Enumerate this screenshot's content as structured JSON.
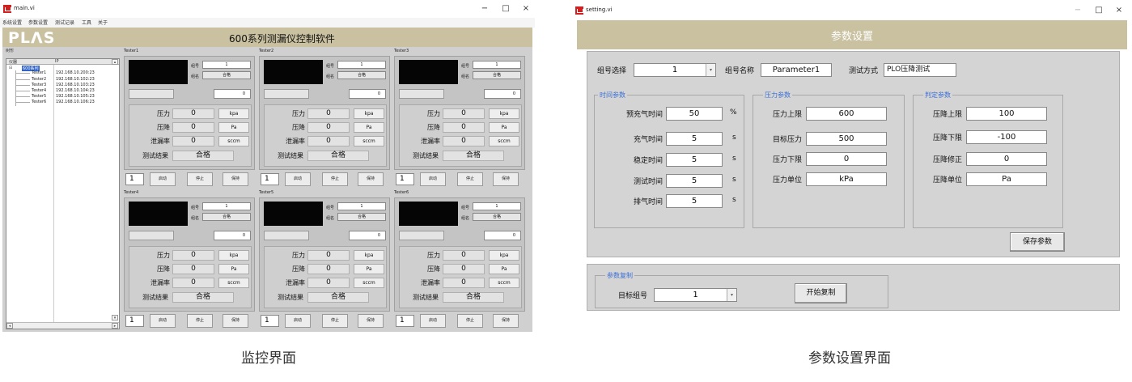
{
  "win1": {
    "title": "main.vi",
    "controls": [
      "−",
      "□",
      "×"
    ],
    "menu": [
      "系统设置",
      "参数设置",
      "测试记录",
      "工具",
      "关于"
    ],
    "logo": "PLΛS",
    "app_title": "600系列测漏仪控制软件",
    "tree": {
      "caption": "树形",
      "col_instrument": "仪器",
      "col_ip": "IP",
      "root": "600系列",
      "items": [
        {
          "name": "Tester1",
          "ip": "192.168.10.200:23"
        },
        {
          "name": "Tester2",
          "ip": "192.168.10.102:23"
        },
        {
          "name": "Tester3",
          "ip": "192.168.10.103:23"
        },
        {
          "name": "Tester4",
          "ip": "192.168.10.104:23"
        },
        {
          "name": "Tester5",
          "ip": "192.168.10.105:23"
        },
        {
          "name": "Tester6",
          "ip": "192.168.10.106:23"
        }
      ],
      "scroll_up": "▴",
      "scroll_down": "▾",
      "scroll_left": "◂",
      "scroll_right": "▸"
    },
    "labels": {
      "group_no": "组号",
      "group_name": "组名",
      "pressure": "压力",
      "pressure_drop": "压降",
      "leak_rate": "泄漏率",
      "result": "测试结果",
      "start": "启动",
      "stop": "停止",
      "hold": "保持"
    },
    "testers": [
      {
        "name": "Tester1",
        "group_no": "1",
        "group_name": "合格",
        "counter": "0",
        "pressure": "0",
        "pressure_unit": "kpa",
        "drop": "0",
        "drop_unit": "Pa",
        "leak": "0",
        "leak_unit": "sccm",
        "result": "合格",
        "count": "1"
      },
      {
        "name": "Tester2",
        "group_no": "1",
        "group_name": "合格",
        "counter": "0",
        "pressure": "0",
        "pressure_unit": "kpa",
        "drop": "0",
        "drop_unit": "Pa",
        "leak": "0",
        "leak_unit": "sccm",
        "result": "合格",
        "count": "1"
      },
      {
        "name": "Tester3",
        "group_no": "1",
        "group_name": "合格",
        "counter": "0",
        "pressure": "0",
        "pressure_unit": "kpa",
        "drop": "0",
        "drop_unit": "Pa",
        "leak": "0",
        "leak_unit": "sccm",
        "result": "合格",
        "count": "1"
      },
      {
        "name": "Tester4",
        "group_no": "1",
        "group_name": "合格",
        "counter": "0",
        "pressure": "0",
        "pressure_unit": "kpa",
        "drop": "0",
        "drop_unit": "Pa",
        "leak": "0",
        "leak_unit": "sccm",
        "result": "合格",
        "count": "1"
      },
      {
        "name": "Tester5",
        "group_no": "1",
        "group_name": "合格",
        "counter": "0",
        "pressure": "0",
        "pressure_unit": "kpa",
        "drop": "0",
        "drop_unit": "Pa",
        "leak": "0",
        "leak_unit": "sccm",
        "result": "合格",
        "count": "1"
      },
      {
        "name": "Tester6",
        "group_no": "1",
        "group_name": "合格",
        "counter": "0",
        "pressure": "0",
        "pressure_unit": "kpa",
        "drop": "0",
        "drop_unit": "Pa",
        "leak": "0",
        "leak_unit": "sccm",
        "result": "合格",
        "count": "1"
      }
    ]
  },
  "win2": {
    "title": "setting.vi",
    "controls": [
      "−",
      "□",
      "×"
    ],
    "header": "参数设置",
    "group_select_label": "组号选择",
    "group_select_value": "1",
    "group_name_label": "组号名称",
    "group_name_value": "Parameter1",
    "test_mode_label": "测试方式",
    "test_mode_value": "PLO压降测试",
    "time_group": {
      "title": "时间参数",
      "rows": [
        {
          "label": "预充气时间",
          "value": "50",
          "unit": "%"
        },
        {
          "label": "充气时间",
          "value": "5",
          "unit": "s"
        },
        {
          "label": "稳定时间",
          "value": "5",
          "unit": "s"
        },
        {
          "label": "测试时间",
          "value": "5",
          "unit": "s"
        },
        {
          "label": "排气时间",
          "value": "5",
          "unit": "s"
        }
      ]
    },
    "pressure_group": {
      "title": "压力参数",
      "rows": [
        {
          "label": "压力上限",
          "value": "600"
        },
        {
          "label": "目标压力",
          "value": "500"
        },
        {
          "label": "压力下限",
          "value": "0"
        },
        {
          "label": "压力单位",
          "value": "kPa"
        }
      ]
    },
    "judge_group": {
      "title": "判定参数",
      "rows": [
        {
          "label": "压降上限",
          "value": "100"
        },
        {
          "label": "压降下限",
          "value": "-100"
        },
        {
          "label": "压降修正",
          "value": "0"
        },
        {
          "label": "压降单位",
          "value": "Pa"
        }
      ]
    },
    "save_button": "保存参数",
    "copy_group": {
      "title": "参数复制",
      "target_label": "目标组号",
      "target_value": "1",
      "start_button": "开始复制"
    }
  },
  "captions": {
    "left": "监控界面",
    "right": "参数设置界面"
  }
}
